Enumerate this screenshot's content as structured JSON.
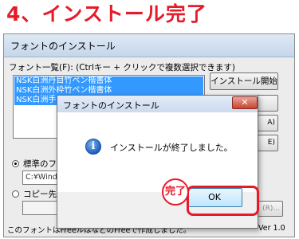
{
  "step_title": "4、インストール完了",
  "main_window": {
    "title": "フォントのインストール",
    "list_label": "フォント一覧(F): (Ctrlキー + クリックで複数選択できます)",
    "fonts": [
      "NSK白洲丹目竹ペン楷書体",
      "NSK白洲外枠竹ペン楷書体",
      "NSK白洲手"
    ],
    "install_button": "インストール開始",
    "partial_buttons": [
      "A)",
      "E)"
    ],
    "radio_standard": "標準のフォ",
    "path_value": "C:¥Window",
    "radio_copy": "コピー先を",
    "browse_partial": "(R)...",
    "bottom_text": "このフォントはFreeルはなどのFreeで作成しました。",
    "version": "Ver 1.0"
  },
  "dialog": {
    "title": "フォントのインストール",
    "close_symbol": "✕",
    "icon": "info-icon",
    "icon_glyph": "i",
    "message": "インストールが終了しました。",
    "ok_label": "OK"
  },
  "annotation": {
    "label": "完了",
    "color": "#e51b2a"
  }
}
